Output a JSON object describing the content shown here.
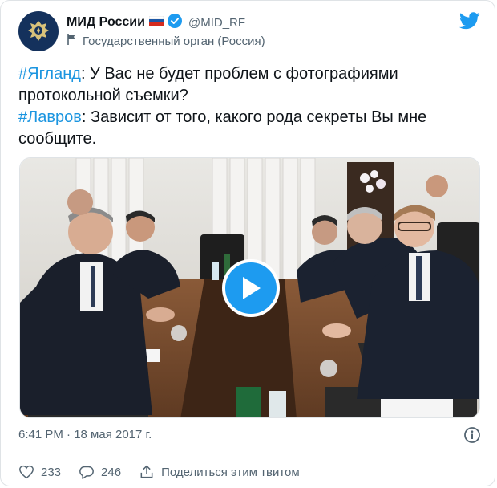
{
  "author": {
    "name": "МИД России",
    "handle": "@MID_RF",
    "account_label": "Государственный орган (Россия)",
    "verified": true,
    "flag": "ru-flag"
  },
  "tweet": {
    "line1_hashtag": "#Ягланд",
    "line1_text": ": У Вас не будет проблем с фотографиями протокольной съемки?",
    "line2_hashtag": "#Лавров",
    "line2_text": ": Зависит от того, какого рода секреты Вы мне сообщите."
  },
  "media": {
    "type": "video",
    "icon": "play-icon"
  },
  "meta": {
    "timestamp": "6:41 PM · 18 мая 2017 г."
  },
  "actions": {
    "likes": "233",
    "replies": "246",
    "share_label": "Поделиться этим твитом"
  },
  "colors": {
    "accent": "#1d9bf0",
    "hashtag": "#1b95e0",
    "muted": "#536471"
  }
}
